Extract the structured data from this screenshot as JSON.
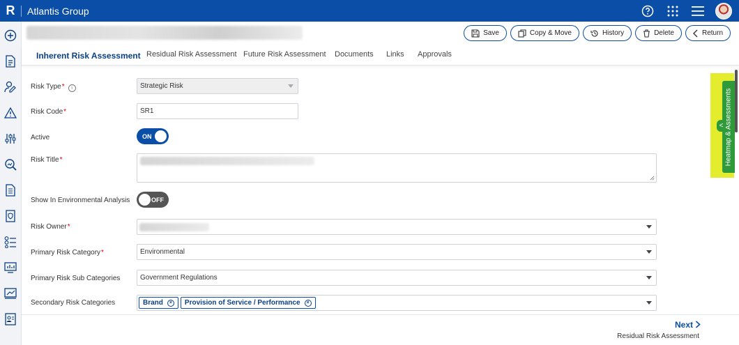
{
  "header": {
    "logo": "R",
    "app_title": "Atlantis Group"
  },
  "sidebar": {
    "icons": [
      "add-icon",
      "document-edit-icon",
      "user-edit-icon",
      "warning-icon",
      "sliders-icon",
      "search-analytics-icon",
      "document-icon",
      "shield-document-icon",
      "checklist-icon",
      "dashboard-icon",
      "chart-icon",
      "report-icon"
    ]
  },
  "actions": {
    "save": "Save",
    "copy_move": "Copy & Move",
    "history": "History",
    "delete": "Delete",
    "return": "Return"
  },
  "tabs": [
    {
      "label": "Inherent Risk Assessment",
      "active": true
    },
    {
      "label": "Residual Risk Assessment"
    },
    {
      "label": "Future Risk Assessment"
    },
    {
      "label": "Documents"
    },
    {
      "label": "Links"
    },
    {
      "label": "Approvals"
    }
  ],
  "form": {
    "risk_type": {
      "label": "Risk Type",
      "value": "Strategic Risk"
    },
    "risk_code": {
      "label": "Risk Code",
      "value": "SR1"
    },
    "active": {
      "label": "Active",
      "state": "ON"
    },
    "risk_title": {
      "label": "Risk Title"
    },
    "show_env": {
      "label": "Show In Environmental Analysis",
      "state": "OFF"
    },
    "risk_owner": {
      "label": "Risk Owner"
    },
    "primary_category": {
      "label": "Primary Risk Category",
      "value": "Environmental"
    },
    "primary_sub": {
      "label": "Primary Risk Sub Categories",
      "value": "Government Regulations"
    },
    "secondary": {
      "label": "Secondary Risk Categories",
      "chips": [
        "Brand",
        "Provision of Service / Performance"
      ]
    }
  },
  "required_mark": "*",
  "info_glyph": "i",
  "chip_remove_glyph": "×",
  "footer": {
    "next": "Next",
    "next_sub": "Residual Risk Assessment"
  },
  "side_panel": {
    "label": "Heatmap & Assessments",
    "chevron": "<"
  },
  "colors": {
    "brand": "#0a4ea8",
    "required": "#dd0000",
    "panel_highlight": "#e4ec2e",
    "panel": "#2e9a3a"
  }
}
